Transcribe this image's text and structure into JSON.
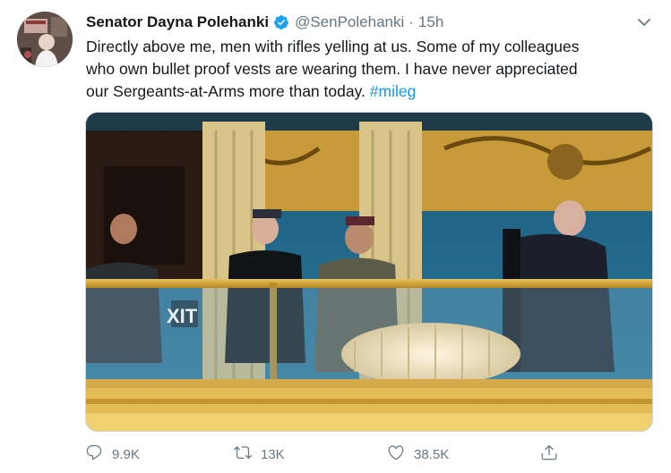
{
  "tweet": {
    "author_name": "Senator Dayna Polehanki",
    "handle": "@SenPolehanki",
    "separator": "·",
    "time": "15h",
    "text_lines": [
      "Directly above me, men with rifles yelling at us. Some of my colleagues",
      "who own bullet proof vests are wearing them. I have never appreciated",
      "our Sergeants-at-Arms more than today."
    ],
    "hashtag": "#mileg",
    "verified": true
  },
  "actions": {
    "replies": "9.9K",
    "retweets": "13K",
    "likes": "38.5K"
  },
  "icons": {
    "menu": "chevron-down-icon",
    "verified": "verified-badge-icon",
    "reply": "reply-icon",
    "retweet": "retweet-icon",
    "like": "heart-icon",
    "share": "share-icon"
  },
  "colors": {
    "text": "#14171a",
    "secondary": "#657786",
    "accent": "#1b95e0",
    "verified": "#1da1f2"
  }
}
